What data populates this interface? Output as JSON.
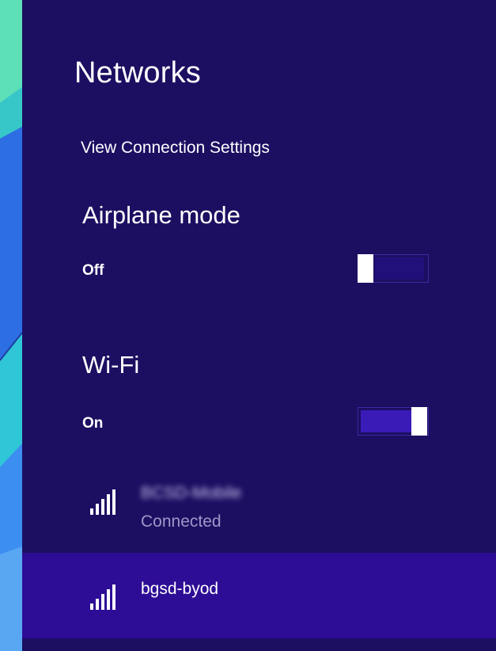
{
  "flyout": {
    "title": "Networks",
    "view_settings_link": "View Connection Settings"
  },
  "airplane_mode": {
    "label": "Airplane mode",
    "state_text": "Off",
    "is_on": false
  },
  "wifi": {
    "label": "Wi-Fi",
    "state_text": "On",
    "is_on": true
  },
  "networks": [
    {
      "name": "BCSD-Mobile",
      "status": "Connected",
      "signal_bars": 5,
      "name_obscured": true,
      "selected": false
    },
    {
      "name": "bgsd-byod",
      "status": "",
      "signal_bars": 5,
      "name_obscured": false,
      "selected": true
    }
  ],
  "colors": {
    "flyout_bg": "#1c0f62",
    "selected_row_bg": "#2e0d96",
    "toggle_on_fill": "#3a1bb8",
    "toggle_off_fill": "#22107a",
    "status_text": "#9e97c8"
  },
  "icons": {
    "signal": "wifi-signal-icon",
    "toggle_thumb": "toggle-thumb"
  }
}
